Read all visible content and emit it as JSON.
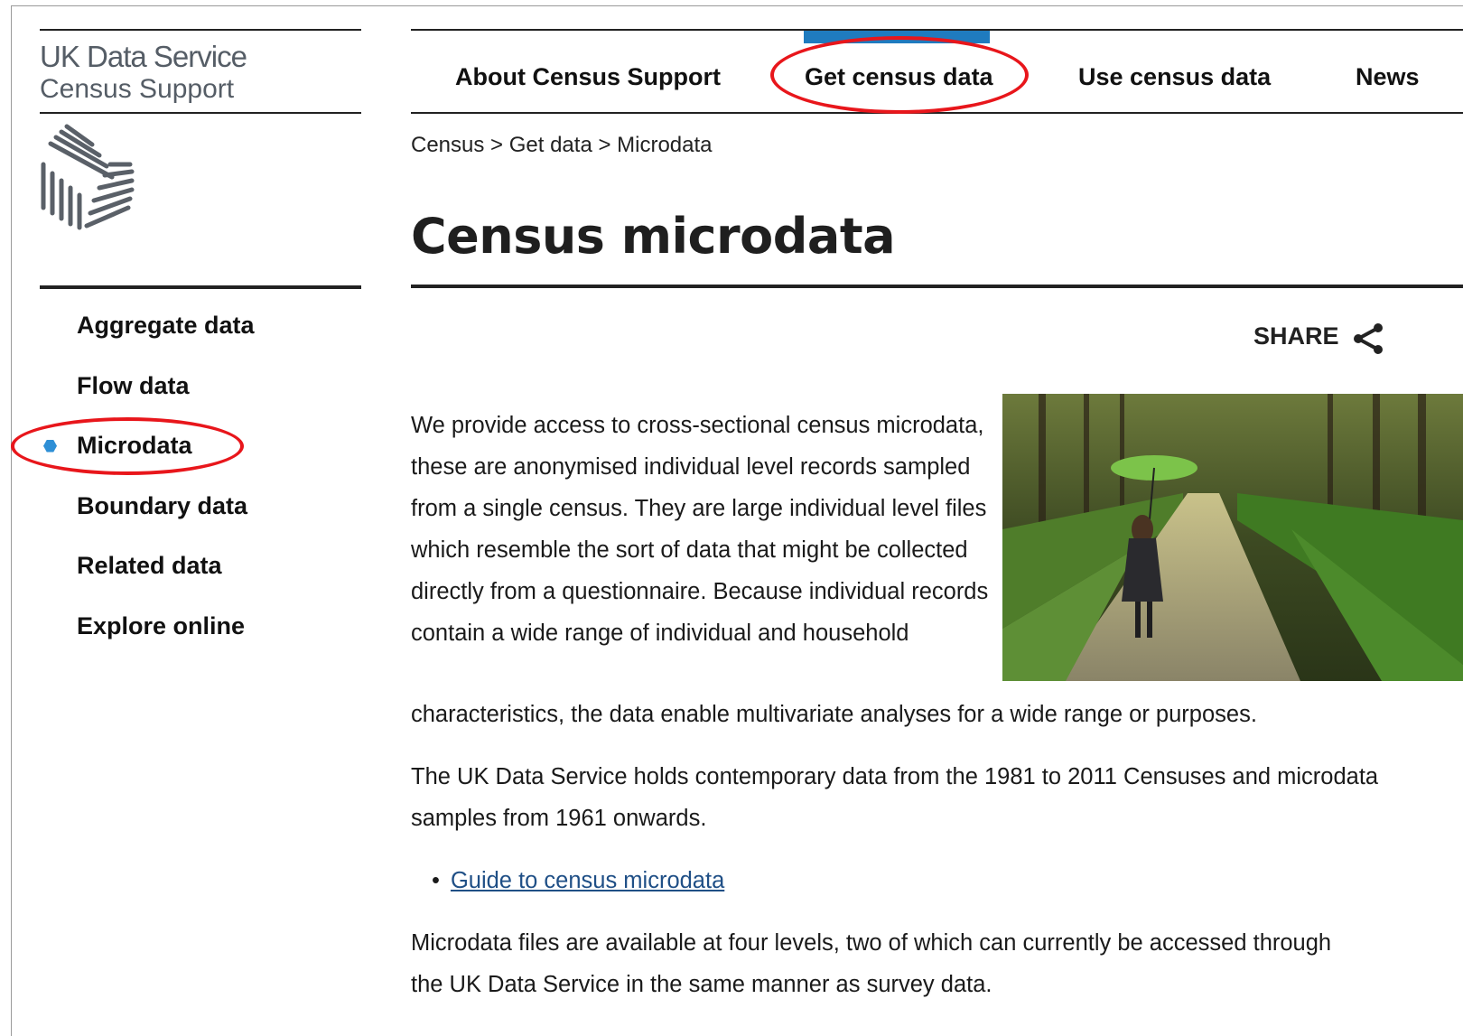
{
  "brand": {
    "line1": "UK Data Service",
    "line2": "Census Support"
  },
  "top_nav": {
    "items": [
      "About Census Support",
      "Get census data",
      "Use census data",
      "News"
    ],
    "active": "Get census data",
    "active_color": "#1f7bbf"
  },
  "sidebar": {
    "items": [
      "Aggregate data",
      "Flow data",
      "Microdata",
      "Boundary data",
      "Related data",
      "Explore online"
    ],
    "active": "Microdata",
    "active_marker_color": "#2e8fd6"
  },
  "breadcrumb": {
    "text": "Census > Get data > Microdata"
  },
  "page": {
    "title": "Census microdata",
    "share_label": "SHARE",
    "share_icon": "share-icon",
    "paragraph1_wrapped": "We provide access to cross-sectional census microdata, these are anonymised individual level records sampled from a single census. They are large individual level files which resemble the sort of data that might be collected directly from a questionnaire. Because individual records contain a wide range of individual and household",
    "paragraph1_tail": "characteristics, the data enable multivariate analyses for a wide range or purposes.",
    "paragraph2": "The UK Data Service holds contemporary data from the 1981 to 2011 Censuses and microdata samples from 1961 onwards.",
    "link_bullet": "•",
    "link_label": "Guide to census microdata",
    "paragraph3_line1": "Microdata files are available at four levels, two of which can currently be accessed through",
    "paragraph3_line2": "the UK Data Service in the same manner as survey data."
  },
  "annotations": {
    "highlight_color": "#e8161b"
  }
}
